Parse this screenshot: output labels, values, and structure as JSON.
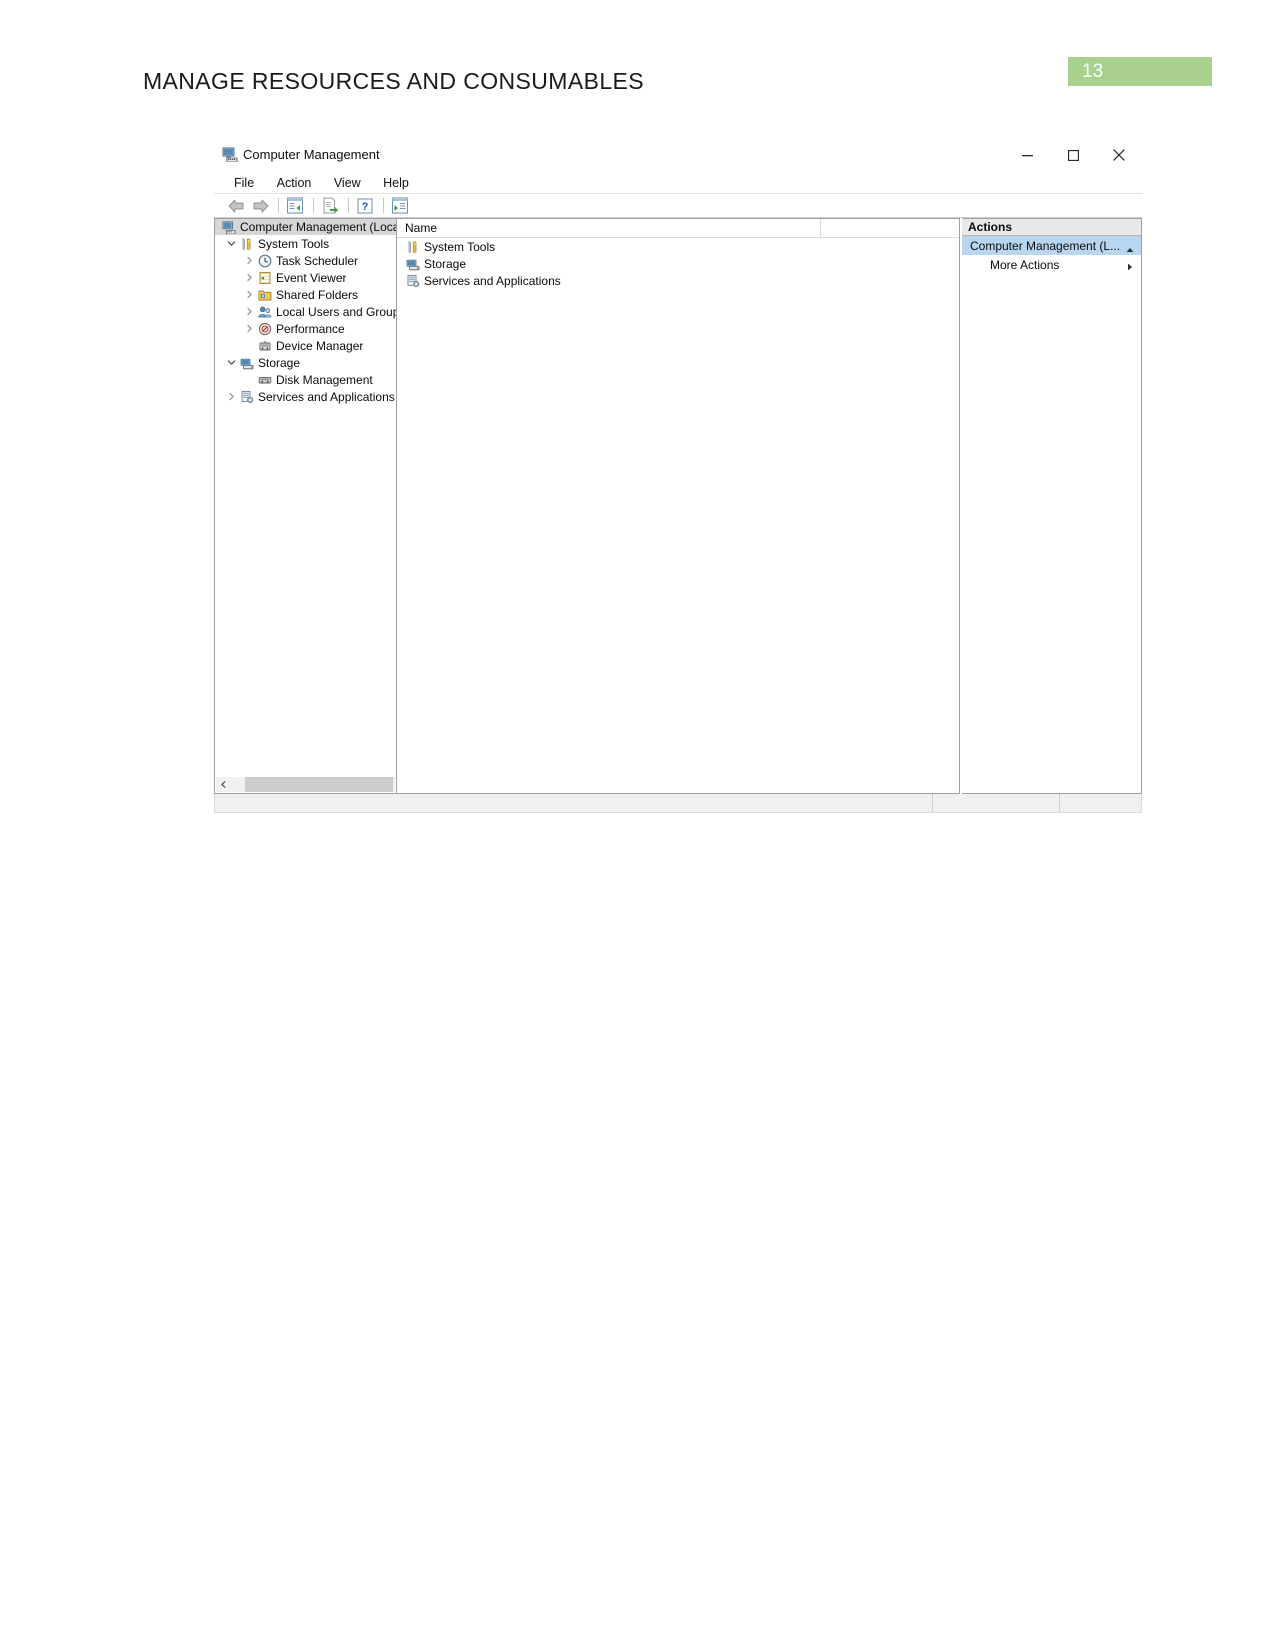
{
  "document": {
    "heading": "MANAGE RESOURCES AND CONSUMABLES",
    "page_number": "13",
    "accent_color": "#a9d18e"
  },
  "window": {
    "title": "Computer Management",
    "icon": "computer-management-icon",
    "controls": {
      "minimize": "minimize-icon",
      "maximize": "maximize-icon",
      "close": "close-icon"
    }
  },
  "menubar": {
    "items": [
      {
        "label": "File"
      },
      {
        "label": "Action"
      },
      {
        "label": "View"
      },
      {
        "label": "Help"
      }
    ]
  },
  "toolbar": {
    "items": [
      {
        "name": "back-icon"
      },
      {
        "name": "forward-icon"
      },
      {
        "name": "show-hide-console-tree-icon"
      },
      {
        "name": "export-list-icon"
      },
      {
        "name": "help-icon"
      },
      {
        "name": "show-hide-action-pane-icon"
      }
    ]
  },
  "tree": {
    "root": {
      "label": "Computer Management (Local",
      "icon": "computer-icon",
      "selected": true
    },
    "nodes": [
      {
        "label": "System Tools",
        "icon": "system-tools-icon",
        "twisty": "expanded",
        "indent": 0
      },
      {
        "label": "Task Scheduler",
        "icon": "clock-icon",
        "twisty": "collapsed",
        "indent": 1
      },
      {
        "label": "Event Viewer",
        "icon": "event-viewer-icon",
        "twisty": "collapsed",
        "indent": 1
      },
      {
        "label": "Shared Folders",
        "icon": "shared-folders-icon",
        "twisty": "collapsed",
        "indent": 1
      },
      {
        "label": "Local Users and Groups",
        "icon": "users-icon",
        "twisty": "collapsed",
        "indent": 1
      },
      {
        "label": "Performance",
        "icon": "performance-icon",
        "twisty": "collapsed",
        "indent": 1
      },
      {
        "label": "Device Manager",
        "icon": "device-manager-icon",
        "twisty": "none",
        "indent": 1
      },
      {
        "label": "Storage",
        "icon": "storage-icon",
        "twisty": "expanded",
        "indent": 0
      },
      {
        "label": "Disk Management",
        "icon": "disk-management-icon",
        "twisty": "none",
        "indent": 1
      },
      {
        "label": "Services and Applications",
        "icon": "services-icon",
        "twisty": "collapsed",
        "indent": 0
      }
    ]
  },
  "list": {
    "columns": [
      {
        "label": "Name"
      },
      {
        "label": ""
      }
    ],
    "rows": [
      {
        "label": "System Tools",
        "icon": "system-tools-icon"
      },
      {
        "label": "Storage",
        "icon": "storage-icon"
      },
      {
        "label": "Services and Applications",
        "icon": "services-icon"
      }
    ]
  },
  "actions": {
    "title": "Actions",
    "group": {
      "label": "Computer Management (L...",
      "icon": "chevron-up-icon"
    },
    "items": [
      {
        "label": "More Actions",
        "icon": "chevron-right-icon"
      }
    ]
  }
}
